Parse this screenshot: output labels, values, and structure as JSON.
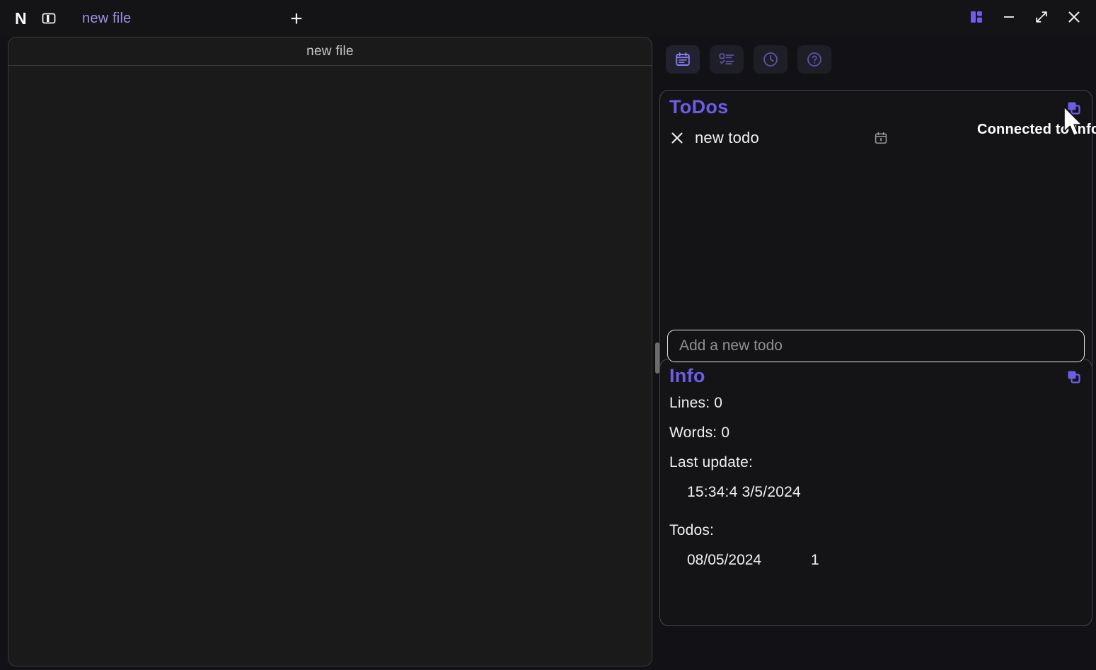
{
  "window": {
    "app_logo": "n-logo",
    "sidebar_toggle_icon": "sidebar-toggle-icon",
    "controls": {
      "layout_icon": "layout-panel-icon",
      "minimize_icon": "minimize-icon",
      "maximize_icon": "maximize-icon",
      "close_icon": "close-icon"
    }
  },
  "tabs": {
    "items": [
      {
        "label": "new file",
        "active": true
      }
    ],
    "add_label": "+"
  },
  "editor": {
    "file_title": "new file",
    "content": ""
  },
  "toolbar": {
    "buttons": [
      {
        "name": "notes-button",
        "icon": "notes-calendar-icon",
        "active": true
      },
      {
        "name": "todos-button",
        "icon": "checklist-icon",
        "active": false
      },
      {
        "name": "history-button",
        "icon": "clock-icon",
        "active": false
      },
      {
        "name": "help-button",
        "icon": "question-circle-icon",
        "active": false
      }
    ]
  },
  "todos_panel": {
    "title": "ToDos",
    "connect_icon": "connect-copy-icon",
    "items": [
      {
        "delete_icon": "close-icon",
        "text": "new todo",
        "calendar_icon": "calendar-icon"
      }
    ],
    "input_placeholder": "Add a new todo",
    "input_value": ""
  },
  "info_panel": {
    "title": "Info",
    "connect_icon": "connect-copy-icon",
    "lines_label": "Lines: 0",
    "words_label": "Words: 0",
    "last_update_label": "Last update:",
    "last_update_value": "15:34:4  3/5/2024",
    "todos_label": "Todos:",
    "todos_rows": [
      {
        "date": "08/05/2024",
        "count": "1"
      }
    ]
  },
  "tooltip": {
    "text": "Connected to Info"
  },
  "colors": {
    "accent_purple": "#6c5ce7",
    "tab_purple": "#9b90e8",
    "window_bg": "#121216",
    "editor_bg": "#1a1a1a",
    "card_bg": "#141417",
    "border": "#46464b",
    "text": "#f0f0f0"
  }
}
